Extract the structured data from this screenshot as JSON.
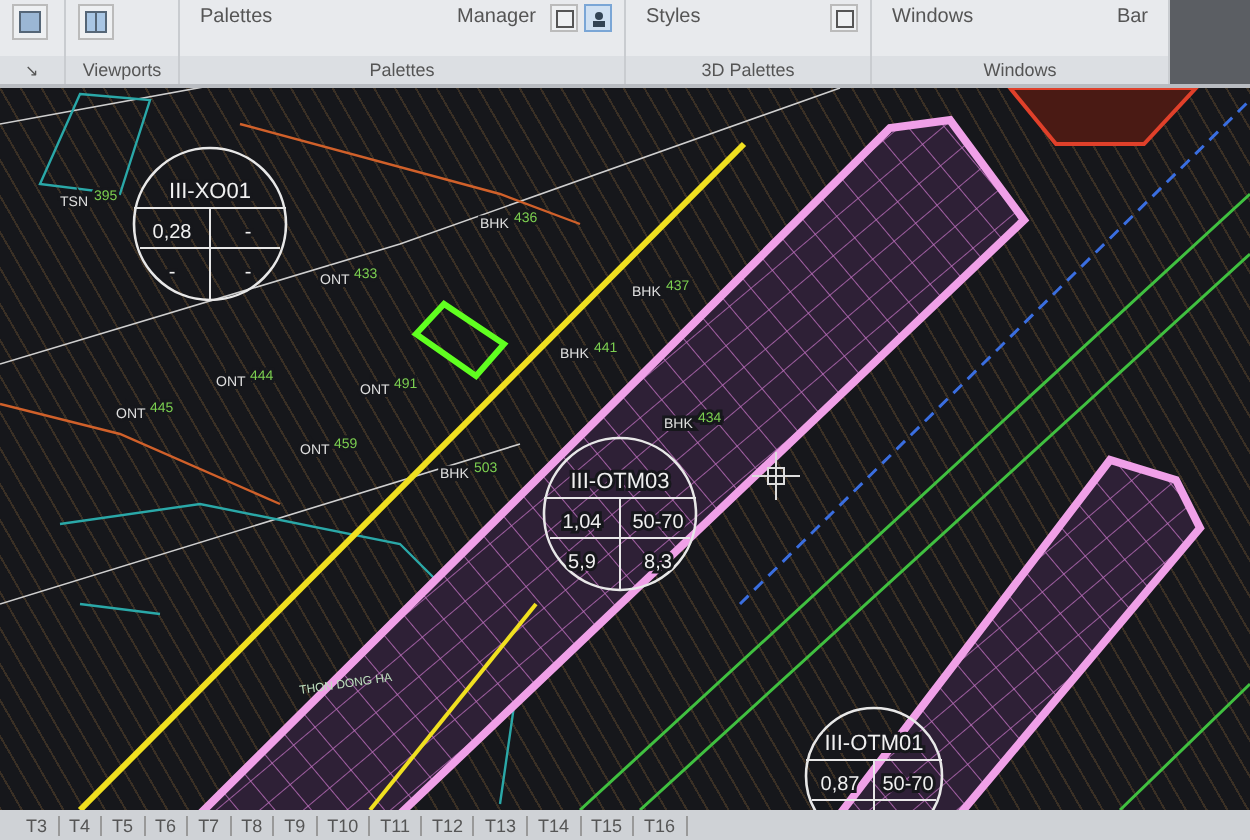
{
  "ribbon": {
    "buttons": [
      {
        "label": "Palettes"
      },
      {
        "label": "Manager"
      },
      {
        "label": "Styles"
      },
      {
        "label": "Windows"
      },
      {
        "label": "Bar"
      }
    ],
    "expander": "↘",
    "panels": [
      {
        "label": "Viewports"
      },
      {
        "label": "Palettes"
      },
      {
        "label": "3D Palettes"
      },
      {
        "label": "Windows"
      }
    ]
  },
  "drawing": {
    "zones": [
      {
        "code": "III-XO01",
        "cells": [
          "0,28",
          "-",
          "-",
          "-"
        ]
      },
      {
        "code": "III-OTM03",
        "cells": [
          "1,04",
          "50-70",
          "5,9",
          "8,3"
        ]
      },
      {
        "code": "III-OTM01",
        "cells": [
          "0,87",
          "50-70"
        ]
      }
    ],
    "parcels": [
      {
        "use": "ONT",
        "number": "433"
      },
      {
        "use": "ONT",
        "number": "444"
      },
      {
        "use": "ONT",
        "number": "445"
      },
      {
        "use": "ONT",
        "number": "491"
      },
      {
        "use": "BHK",
        "number": "436"
      },
      {
        "use": "BHK",
        "number": "441"
      },
      {
        "use": "BHK",
        "number": "437"
      },
      {
        "use": "BHK",
        "number": "434"
      },
      {
        "use": "BHK",
        "number": "503"
      },
      {
        "use": "TSN",
        "number": "395"
      },
      {
        "use": "ONT",
        "number": "459"
      }
    ],
    "place_name": "THON DONG HA"
  },
  "layout_tabs": [
    {
      "label": "T3"
    },
    {
      "label": "T4"
    },
    {
      "label": "T5"
    },
    {
      "label": "T6"
    },
    {
      "label": "T7"
    },
    {
      "label": "T8"
    },
    {
      "label": "T9"
    },
    {
      "label": "T10"
    },
    {
      "label": "T11"
    },
    {
      "label": "T12"
    },
    {
      "label": "T13"
    },
    {
      "label": "T14"
    },
    {
      "label": "T15"
    },
    {
      "label": "T16"
    }
  ]
}
